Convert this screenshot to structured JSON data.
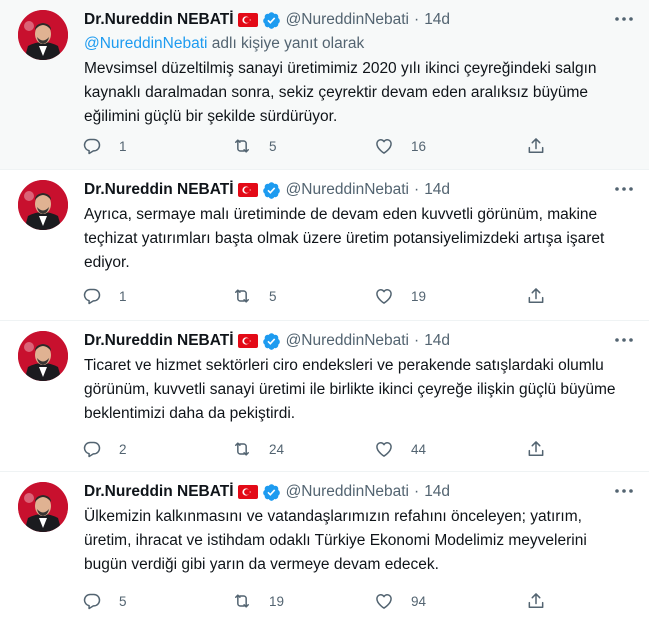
{
  "tweets": [
    {
      "name": "Dr.Nureddin NEBATİ",
      "handle": "@NureddinNebati",
      "dot": "·",
      "time": "14d",
      "reply_mention": "@NureddinNebati",
      "reply_suffix": " adlı kişiye yanıt olarak",
      "text": "Mevsimsel düzeltilmiş sanayi üretimimiz 2020 yılı ikinci çeyreğindeki salgın kaynaklı daralmadan sonra, sekiz çeyrektir devam eden aralıksız büyüme eğilimini güçlü bir şekilde sürdürüyor.",
      "replies": "1",
      "retweets": "5",
      "likes": "16"
    },
    {
      "name": "Dr.Nureddin NEBATİ",
      "handle": "@NureddinNebati",
      "dot": "·",
      "time": "14d",
      "text": "Ayrıca, sermaye malı üretiminde de devam eden kuvvetli görünüm, makine teçhizat yatırımları başta olmak üzere üretim potansiyelimizdeki artışa işaret ediyor.",
      "replies": "1",
      "retweets": "5",
      "likes": "19"
    },
    {
      "name": "Dr.Nureddin NEBATİ",
      "handle": "@NureddinNebati",
      "dot": "·",
      "time": "14d",
      "text": "Ticaret ve hizmet sektörleri ciro endeksleri ve perakende satışlardaki olumlu görünüm, kuvvetli sanayi üretimi ile birlikte ikinci çeyreğe ilişkin güçlü büyüme beklentimizi daha da pekiştirdi.",
      "replies": "2",
      "retweets": "24",
      "likes": "44"
    },
    {
      "name": "Dr.Nureddin NEBATİ",
      "handle": "@NureddinNebati",
      "dot": "·",
      "time": "14d",
      "text": "Ülkemizin kalkınmasını ve vatandaşlarımızın refahını önceleyen; yatırım, üretim, ihracat ve istihdam odaklı Türkiye Ekonomi Modelimiz meyvelerini bugün verdiği gibi yarın da vermeye devam edecek.",
      "replies": "5",
      "retweets": "19",
      "likes": "94"
    }
  ],
  "colors": {
    "accent": "#1d9bf0",
    "secondary_text": "#536471",
    "primary_text": "#0f1419",
    "highlight_bg": "#f7f9f9",
    "divider": "#eff3f4",
    "flag_red": "#e30a17"
  },
  "icons": [
    "avatar",
    "turkey-flag-icon",
    "verified-badge-icon",
    "more-icon",
    "reply-icon",
    "retweet-icon",
    "like-icon",
    "share-icon"
  ]
}
